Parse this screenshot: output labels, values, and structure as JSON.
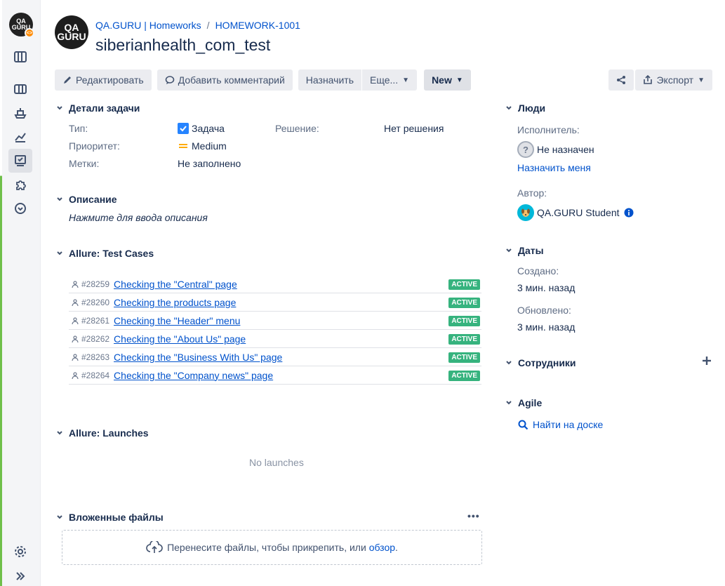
{
  "sidebar": {
    "logo_text": "QA GURU",
    "items": [
      "board-icon",
      "backlog-icon",
      "releases-icon",
      "reports-icon",
      "issues-icon",
      "addons-icon",
      "timer-icon"
    ],
    "settings": "settings-icon",
    "expand": "expand-icon"
  },
  "header": {
    "project_avatar_text": "QA GURU",
    "breadcrumb_project": "QA.GURU | Homeworks",
    "breadcrumb_sep": "/",
    "breadcrumb_issue": "HOMEWORK-1001",
    "title": "siberianhealth_com_test"
  },
  "toolbar": {
    "edit_label": "Редактировать",
    "comment_label": "Добавить комментарий",
    "assign_label": "Назначить",
    "more_label": "Еще...",
    "status_label": "New",
    "export_label": "Экспорт"
  },
  "details": {
    "heading": "Детали задачи",
    "type_label": "Тип:",
    "type_value": "Задача",
    "priority_label": "Приоритет:",
    "priority_value": "Medium",
    "labels_label": "Метки:",
    "labels_value": "Не заполнено",
    "resolution_label": "Решение:",
    "resolution_value": "Нет решения"
  },
  "description": {
    "heading": "Описание",
    "placeholder": "Нажмите для ввода описания"
  },
  "allure_cases": {
    "heading": "Allure: Test Cases",
    "rows": [
      {
        "id": "#28259",
        "name": "Checking the \"Central\" page",
        "status": "ACTIVE"
      },
      {
        "id": "#28260",
        "name": "Checking the products page",
        "status": "ACTIVE"
      },
      {
        "id": "#28261",
        "name": "Checking the \"Header\" menu",
        "status": "ACTIVE"
      },
      {
        "id": "#28262",
        "name": "Checking the \"About Us\" page",
        "status": "ACTIVE"
      },
      {
        "id": "#28263",
        "name": "Checking the \"Business With Us\" page",
        "status": "ACTIVE"
      },
      {
        "id": "#28264",
        "name": "Checking the \"Company news\" page",
        "status": "ACTIVE"
      }
    ]
  },
  "allure_launches": {
    "heading": "Allure: Launches",
    "empty": "No launches"
  },
  "attachments": {
    "heading": "Вложенные файлы",
    "drop_text": "Перенесите файлы, чтобы прикрепить, или",
    "browse_link": "обзор",
    "drop_end": "."
  },
  "people": {
    "heading": "Люди",
    "assignee_label": "Исполнитель:",
    "assignee_value": "Не назначен",
    "assign_me": "Назначить меня",
    "author_label": "Автор:",
    "author_value": "QA.GURU Student"
  },
  "dates": {
    "heading": "Даты",
    "created_label": "Создано:",
    "created_value": "3 мин. назад",
    "updated_label": "Обновлено:",
    "updated_value": "3 мин. назад"
  },
  "watchers": {
    "heading": "Сотрудники"
  },
  "agile": {
    "heading": "Agile",
    "board_link": "Найти на доске"
  },
  "colors": {
    "link": "#0052cc",
    "active_badge": "#36b37e",
    "priority_medium": "#ffab00",
    "checkbox": "#2684ff"
  }
}
